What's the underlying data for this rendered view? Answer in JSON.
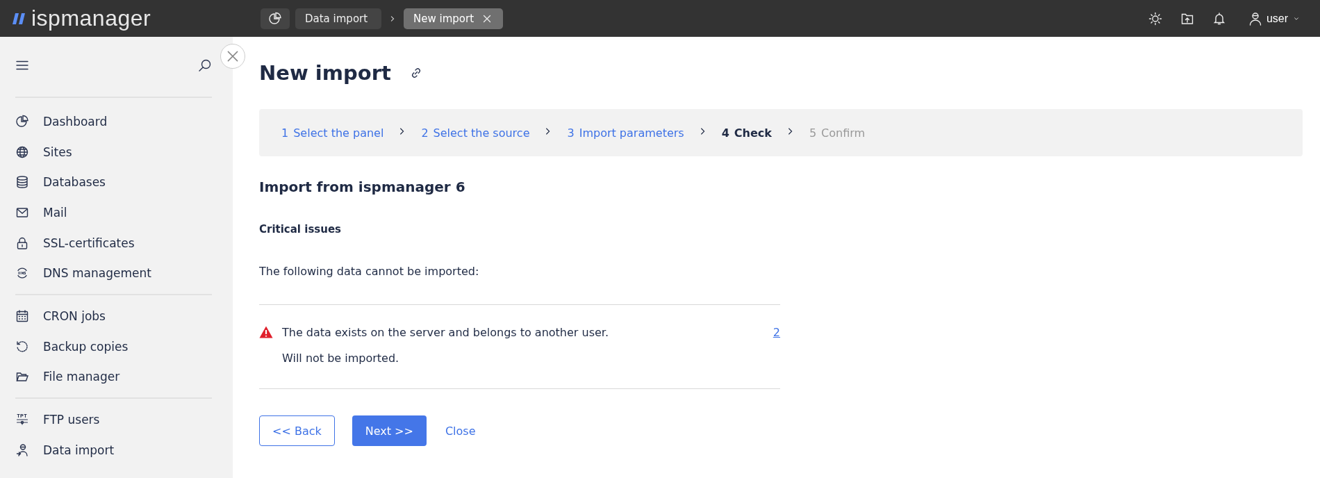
{
  "topbar": {
    "logo": "ispmanager",
    "breadcrumbs": [
      {
        "label": "Data import",
        "selected": false
      },
      {
        "label": "New import",
        "selected": true
      }
    ],
    "user": "user"
  },
  "sidebar": {
    "groups": [
      [
        "Dashboard",
        "Sites",
        "Databases",
        "Mail",
        "SSL-certificates",
        "DNS management"
      ],
      [
        "CRON jobs",
        "Backup copies",
        "File manager"
      ],
      [
        "FTP users",
        "Data import"
      ]
    ]
  },
  "page": {
    "title": "New import",
    "steps": [
      {
        "number": "1",
        "label": "Select the panel",
        "completed": true,
        "selected": false
      },
      {
        "number": "2",
        "label": "Select the source",
        "completed": true,
        "selected": false
      },
      {
        "number": "3",
        "label": "Import parameters",
        "completed": true,
        "selected": false
      },
      {
        "number": "4",
        "label": "Check",
        "completed": false,
        "selected": true
      },
      {
        "number": "5",
        "label": "Confirm",
        "completed": false,
        "selected": false
      }
    ],
    "section_title": "Import from ispmanager 6",
    "subtitle": "Critical issues",
    "intro": "The following data cannot be imported:",
    "issues": [
      {
        "message": "The data exists on the server and belongs to another user.",
        "note": "Will not be imported.",
        "count": "2"
      }
    ],
    "buttons": {
      "back": "<< Back",
      "next": "Next >>",
      "close": "Close"
    }
  }
}
